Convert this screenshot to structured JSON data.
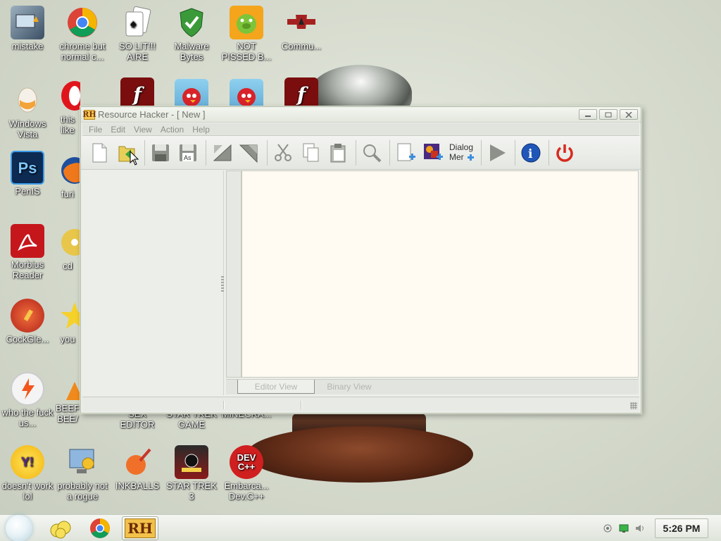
{
  "desktop": {
    "icons": [
      {
        "label": "mistake",
        "icon": "computer-upload-icon"
      },
      {
        "label": "chrome but normal c...",
        "icon": "chrome-icon"
      },
      {
        "label": "SO LIT!!! AIRE",
        "icon": "solitaire-icon"
      },
      {
        "label": "Malware Bytes",
        "icon": "shield-icon"
      },
      {
        "label": "NOT PISSED B...",
        "icon": "angry-pig-icon"
      },
      {
        "label": "Commu...",
        "icon": "papers-please-icon"
      },
      {
        "label": "Windows Vista",
        "icon": "egg-icon"
      },
      {
        "label": "this like",
        "icon": "opera-icon"
      },
      {
        "label": "PenIS",
        "icon": "photoshop-icon",
        "text": "Ps"
      },
      {
        "label": "furi",
        "icon": "firefox-icon"
      },
      {
        "label": "Morbius Reader",
        "icon": "adobe-reader-icon"
      },
      {
        "label": "cd",
        "icon": "cd-icon"
      },
      {
        "label": "CockGle...",
        "icon": "ccleaner-icon"
      },
      {
        "label": "you",
        "icon": "star-icon"
      },
      {
        "label": "who the fuck us...",
        "icon": "lightning-icon"
      },
      {
        "label": "BEEF BEE/",
        "icon": "vlc-icon"
      },
      {
        "label": "SEX EDITOR",
        "icon": "editor-icon"
      },
      {
        "label": "STAR TREK GAME",
        "icon": "game-icon"
      },
      {
        "label": "MINECRA...",
        "icon": "minecraft-icon"
      },
      {
        "label": "doesn't work lol",
        "icon": "yahoo-messenger-icon",
        "text": "Y!"
      },
      {
        "label": "probably not a rogue",
        "icon": "computer-gear-icon"
      },
      {
        "label": "INKBALLS",
        "icon": "inkball-icon"
      },
      {
        "label": "STAR TREK 3",
        "icon": "star-wars-icon"
      },
      {
        "label": "Embarca... Dev.C++",
        "icon": "devcpp-icon",
        "text": "DEV C++"
      },
      {
        "label": "",
        "icon": "flash-icon",
        "text": "f"
      },
      {
        "label": "",
        "icon": "angry-bird-icon"
      },
      {
        "label": "",
        "icon": "angry-bird-icon"
      },
      {
        "label": "",
        "icon": "flash-icon",
        "text": "f"
      }
    ]
  },
  "window": {
    "title": "Resource Hacker - [ New ]",
    "icon_text": "RH",
    "controls": {
      "minimize": "minimize",
      "maximize": "maximize",
      "close": "close"
    },
    "menu": [
      "File",
      "Edit",
      "View",
      "Action",
      "Help"
    ],
    "toolbar": [
      {
        "name": "new-file-icon"
      },
      {
        "name": "open-file-icon"
      },
      {
        "name": "save-icon"
      },
      {
        "name": "save-as-icon",
        "text": "As"
      },
      {
        "name": "compile-back-icon"
      },
      {
        "name": "compile-forward-icon"
      },
      {
        "name": "cut-icon"
      },
      {
        "name": "copy-icon"
      },
      {
        "name": "paste-icon"
      },
      {
        "name": "find-icon"
      },
      {
        "name": "add-resource-icon"
      },
      {
        "name": "add-image-resource-icon"
      },
      {
        "name": "dialog-merger-icon",
        "text_line1": "Dialog",
        "text_line2": "Mer"
      },
      {
        "name": "run-script-icon"
      },
      {
        "name": "info-icon",
        "text": "i"
      },
      {
        "name": "exit-icon"
      }
    ],
    "view_tabs": {
      "editor": "Editor View",
      "binary": "Binary View"
    }
  },
  "taskbar": {
    "clock": "5:26 PM",
    "pinned": [
      "explorer-icon",
      "chrome-icon",
      "resource-hacker-icon"
    ],
    "resource_hacker_text": "RH"
  },
  "colors": {
    "accent_window_border": "#d7e0c8",
    "editor_bg": "#fffaf2",
    "exit_red": "#d62a20",
    "info_blue": "#1f56b8"
  }
}
